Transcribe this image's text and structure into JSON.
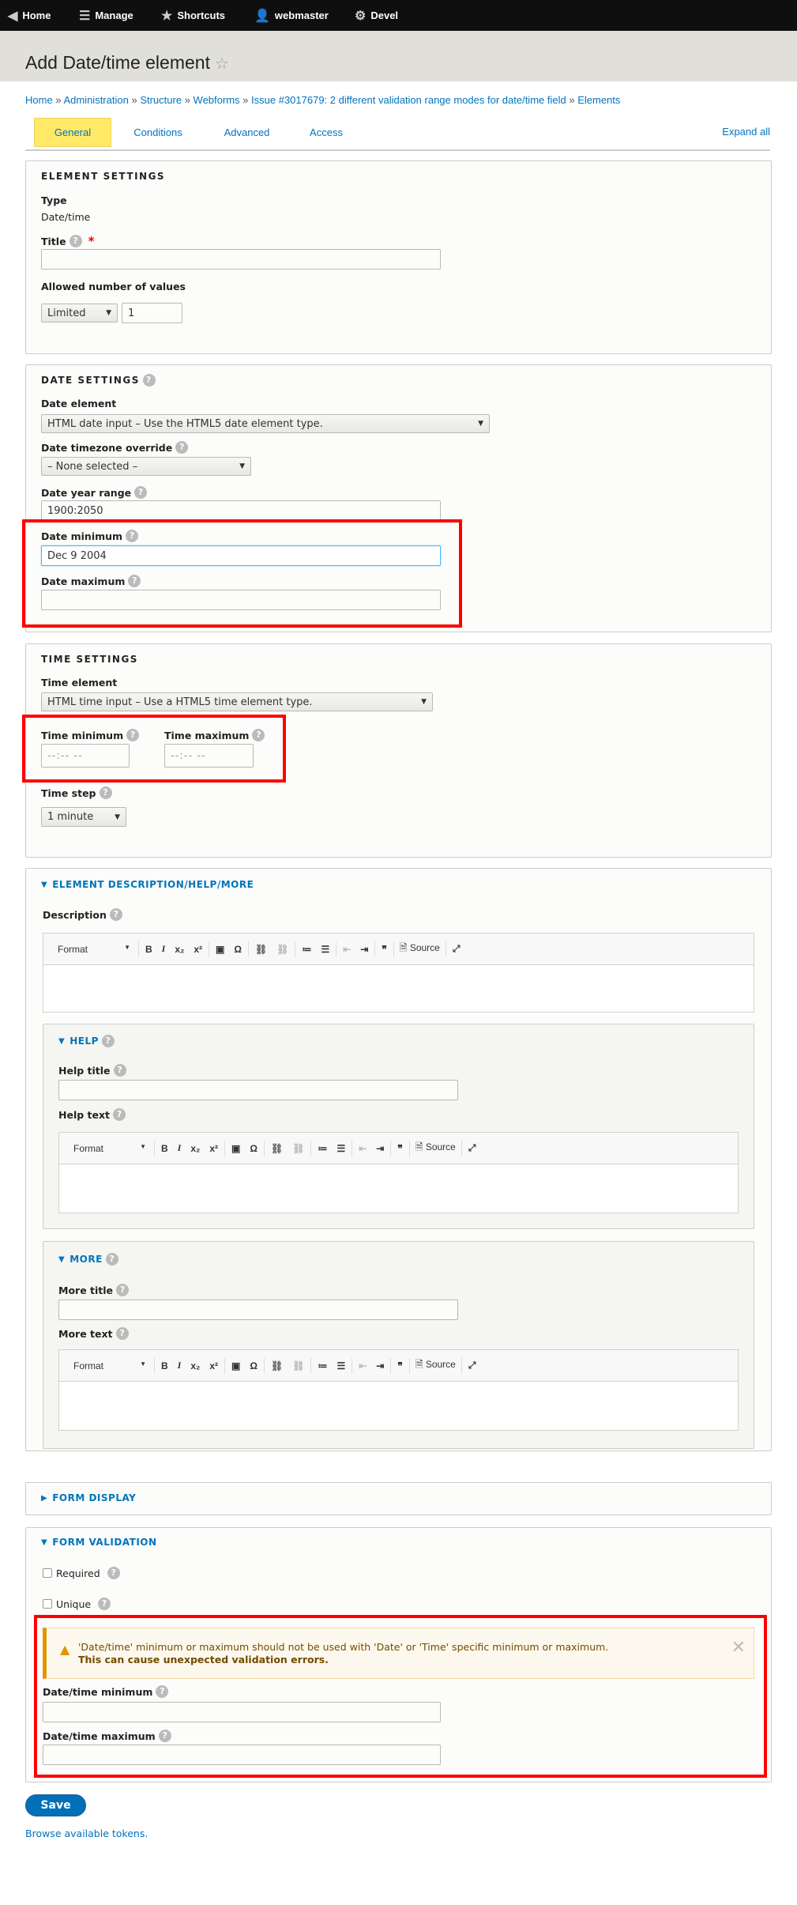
{
  "toolbar": {
    "home": "Home",
    "manage": "Manage",
    "shortcuts": "Shortcuts",
    "user": "webmaster",
    "devel": "Devel"
  },
  "page": {
    "title": "Add Date/time element"
  },
  "breadcrumb": [
    "Home",
    "Administration",
    "Structure",
    "Webforms",
    "Issue #3017679: 2 different validation range modes for date/time field",
    "Elements"
  ],
  "breadcrumb_sep": "»",
  "tabs": [
    "General",
    "Conditions",
    "Advanced",
    "Access"
  ],
  "expand_all": "Expand all",
  "element_settings": {
    "legend": "Element settings",
    "type_label": "Type",
    "type_value": "Date/time",
    "title_label": "Title",
    "title_value": "",
    "allowed_label": "Allowed number of values",
    "allowed_select": "Limited",
    "allowed_number": "1"
  },
  "date_settings": {
    "legend": "Date settings",
    "element_label": "Date element",
    "element_value": "HTML date input – Use the HTML5 date element type.",
    "tz_label": "Date timezone override",
    "tz_value": "– None selected –",
    "year_label": "Date year range",
    "year_value": "1900:2050",
    "min_label": "Date minimum",
    "min_value": "Dec 9 2004",
    "max_label": "Date maximum",
    "max_value": ""
  },
  "time_settings": {
    "legend": "Time settings",
    "element_label": "Time element",
    "element_value": "HTML time input – Use a HTML5 time element type.",
    "min_label": "Time minimum",
    "max_label": "Time maximum",
    "time_placeholder": "--:-- --",
    "step_label": "Time step",
    "step_value": "1 minute"
  },
  "description": {
    "legend": "Element description/help/more",
    "desc_label": "Description",
    "help_legend": "Help",
    "help_title_label": "Help title",
    "help_text_label": "Help text",
    "more_legend": "More",
    "more_title_label": "More title",
    "more_text_label": "More text"
  },
  "editor": {
    "format": "Format",
    "source": "Source"
  },
  "form_display": {
    "legend": "Form display"
  },
  "validation": {
    "legend": "Form validation",
    "required": "Required",
    "unique": "Unique",
    "warning_line1": "'Date/time' minimum or maximum should not be used with 'Date' or 'Time' specific minimum or maximum.",
    "warning_line2": "This can cause unexpected validation errors.",
    "dt_min_label": "Date/time minimum",
    "dt_max_label": "Date/time maximum"
  },
  "actions": {
    "save": "Save",
    "browse_tokens": "Browse available tokens."
  }
}
